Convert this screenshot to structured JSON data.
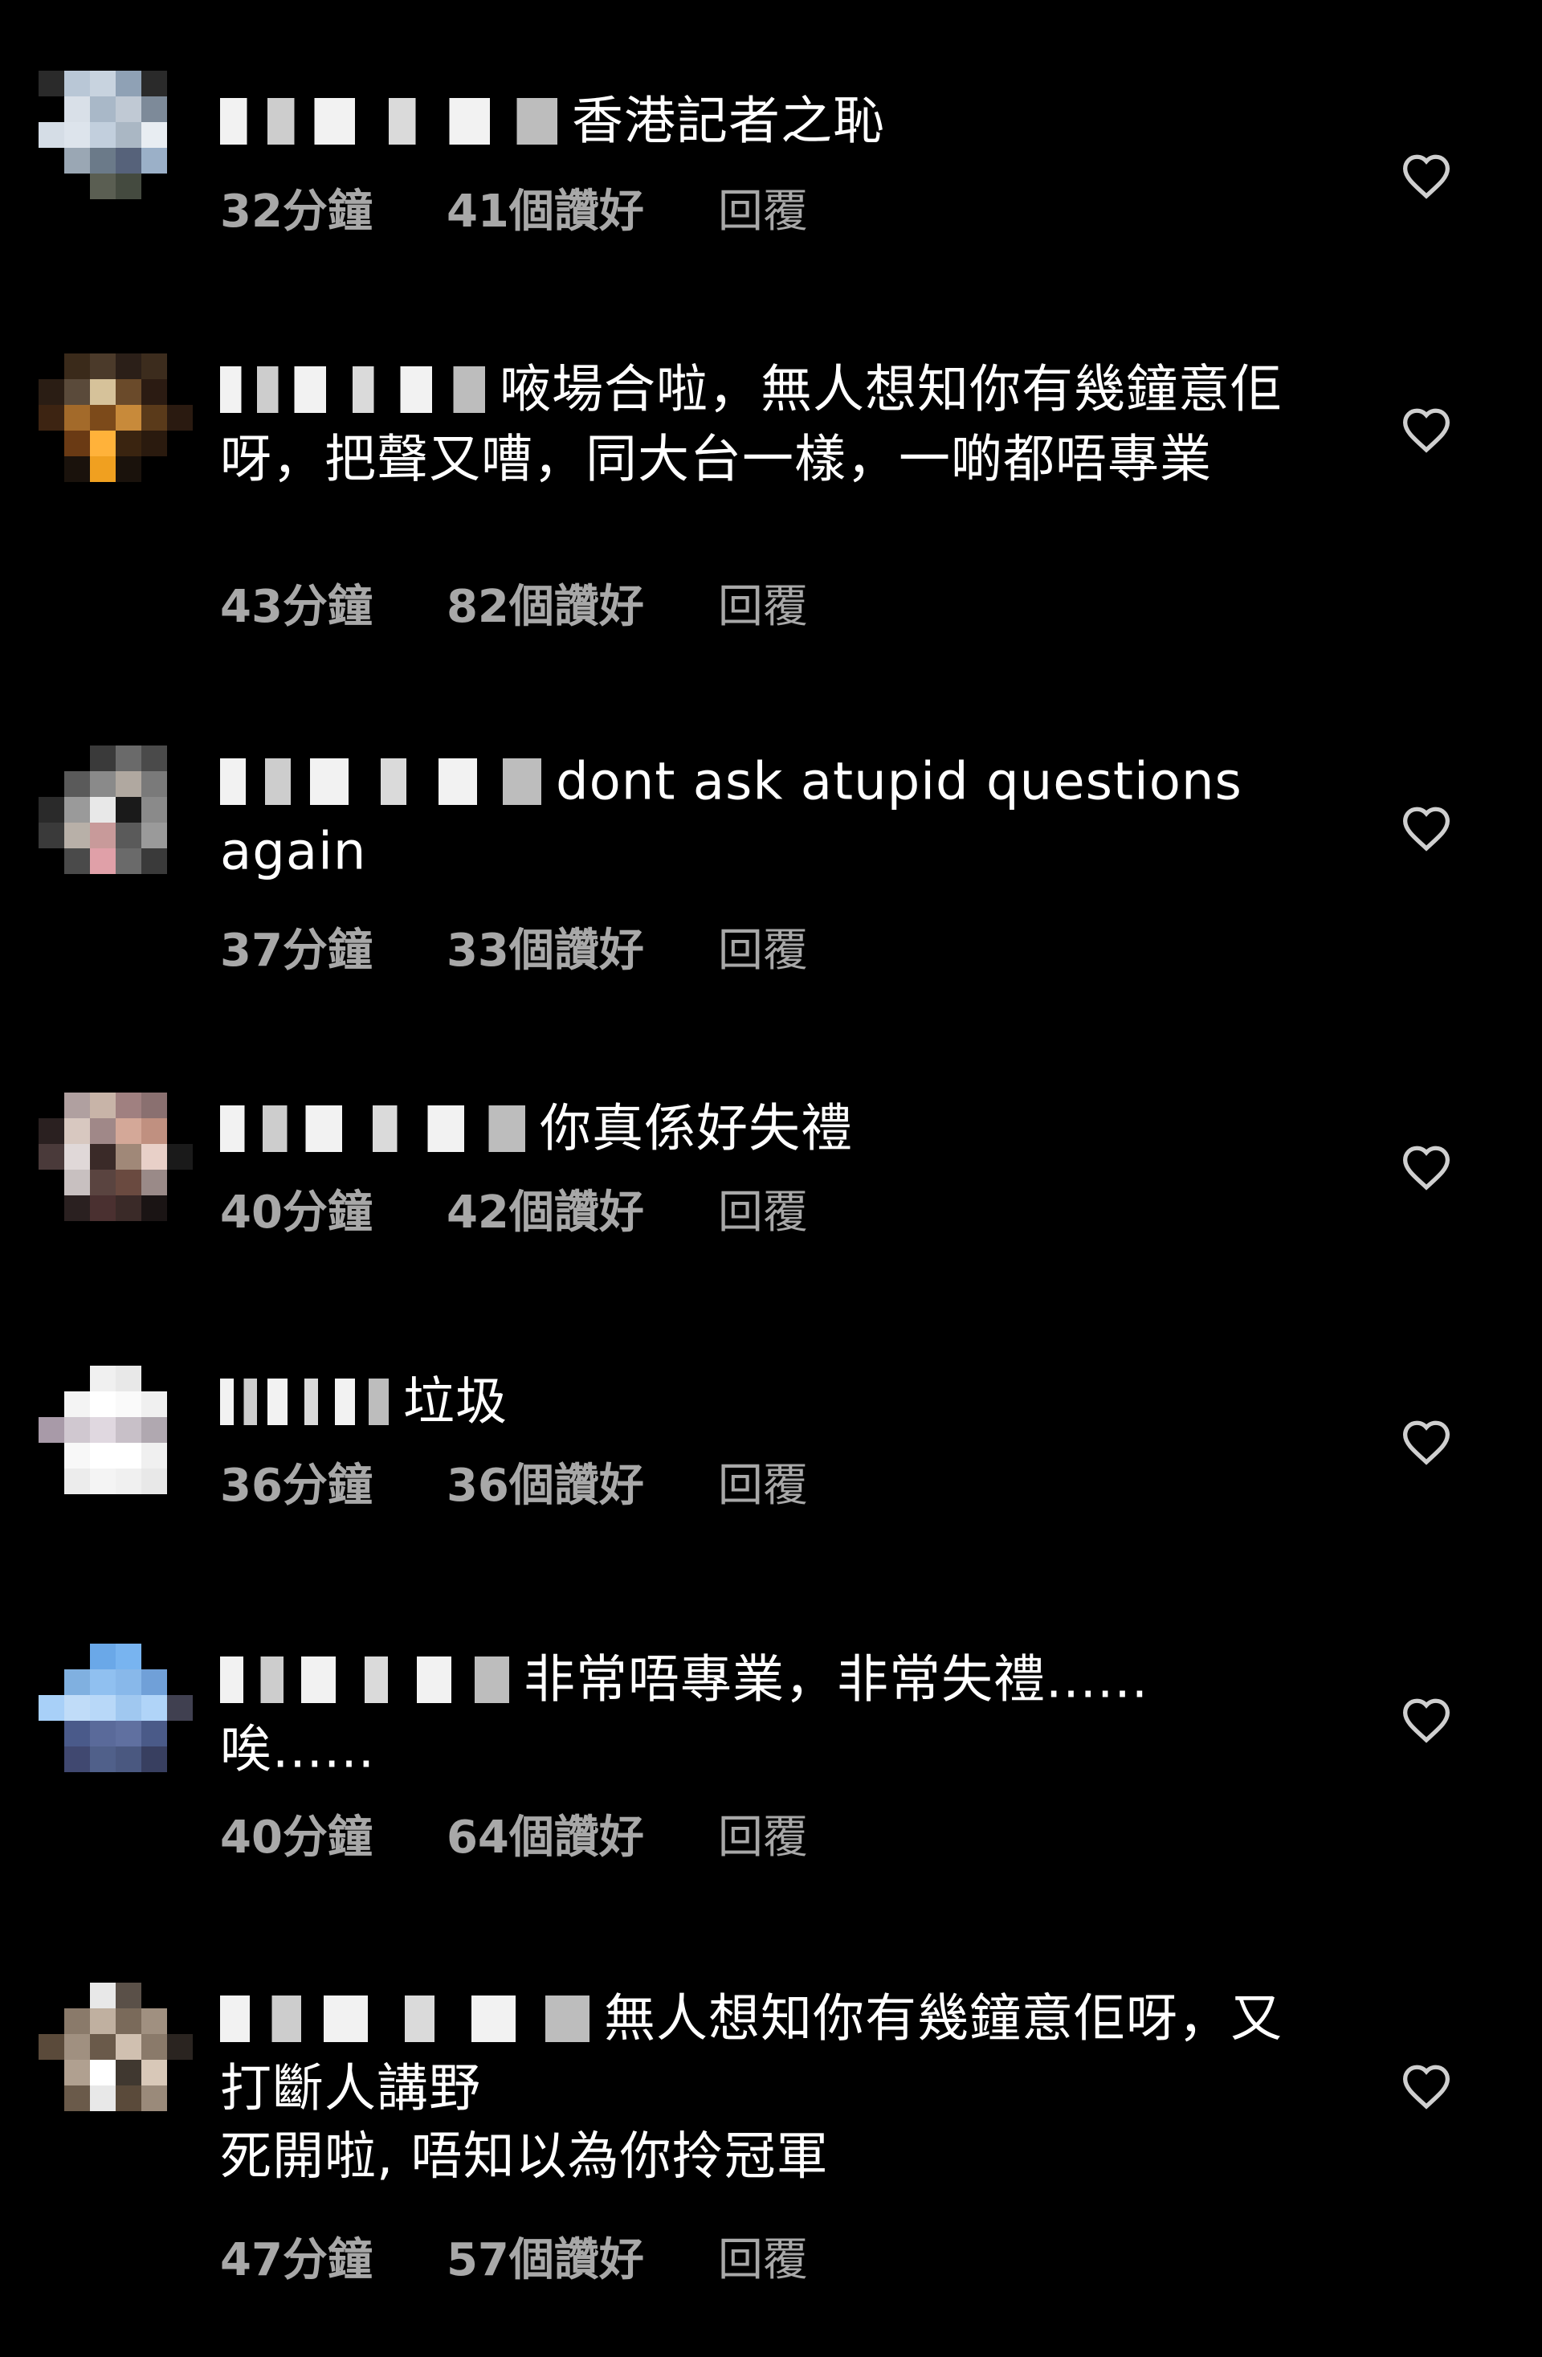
{
  "comments": [
    {
      "text": "香港記者之恥",
      "time": "32分鐘",
      "likes": "41個讚好",
      "reply": "回覆",
      "avatar": [
        "#2a2a2a",
        "#b9c7d6",
        "#c8d3df",
        "#8fa1b5",
        "#2a2a2a",
        "#000000",
        "#000000",
        "#d9e0e8",
        "#a9b8c8",
        "#c0c9d4",
        "#7d8a99",
        "#000000",
        "#d5dde6",
        "#dde4ec",
        "#c2cfdd",
        "#aab7c4",
        "#e8edf2",
        "#000000",
        "#000000",
        "#9aa7b4",
        "#6b7a89",
        "#56627a",
        "#9bb0c8",
        "#000000",
        "#000000",
        "#000000",
        "#5a5e52",
        "#444a3f",
        "#000000",
        "#000000",
        "#000000",
        "#000000",
        "#000000",
        "#000000",
        "#000000",
        "#000000"
      ]
    },
    {
      "text": "㖡場合啦，無人想知你有幾鐘意佢呀，把聲又嘈，同大台一樣，一啲都唔專業",
      "time": "43分鐘",
      "likes": "82個讚好",
      "reply": "回覆",
      "avatar": [
        "#000000",
        "#3a2a1a",
        "#4b3a2a",
        "#2b1f18",
        "#3c2c1d",
        "#000000",
        "#2a1d14",
        "#5a4a3a",
        "#d6c29a",
        "#6a4a2a",
        "#2b1b12",
        "#000000",
        "#3d2412",
        "#a36a2a",
        "#7c4a1a",
        "#c88a3a",
        "#5a3a1a",
        "#2a1a10",
        "#000000",
        "#6a3a14",
        "#ffb23a",
        "#3a2410",
        "#2a1a0e",
        "#000000",
        "#000000",
        "#1a120c",
        "#f0a020",
        "#1a120c",
        "#000000",
        "#000000",
        "#000000",
        "#000000",
        "#000000",
        "#000000",
        "#000000",
        "#000000"
      ]
    },
    {
      "text": "dont ask atupid questions again",
      "time": "37分鐘",
      "likes": "33個讚好",
      "reply": "回覆",
      "avatar": [
        "#000000",
        "#000000",
        "#3a3a3a",
        "#6a6a6a",
        "#4a4a4a",
        "#000000",
        "#000000",
        "#5a5a5a",
        "#8a8a8a",
        "#b0a8a0",
        "#7a7a7a",
        "#000000",
        "#2a2a2a",
        "#9a9a9a",
        "#e8e8e8",
        "#1a1a1a",
        "#8a8a8a",
        "#000000",
        "#3a3a3a",
        "#b8b0a8",
        "#c89a9a",
        "#5a5a5a",
        "#9a9a9a",
        "#000000",
        "#000000",
        "#4a4a4a",
        "#e0a0a8",
        "#6a6a6a",
        "#3a3a3a",
        "#000000",
        "#000000",
        "#000000",
        "#000000",
        "#000000",
        "#000000",
        "#000000"
      ]
    },
    {
      "text": "你真係好失禮",
      "time": "40分鐘",
      "likes": "42個讚好",
      "reply": "回覆",
      "avatar": [
        "#000000",
        "#b0a0a0",
        "#c8b4a8",
        "#a08080",
        "#8a7070",
        "#000000",
        "#2a2020",
        "#d8c8c0",
        "#a08888",
        "#d4a898",
        "#c09080",
        "#000000",
        "#4a3a3a",
        "#e0d8d8",
        "#3a2a28",
        "#a08878",
        "#e8d0c8",
        "#1a1a1a",
        "#000000",
        "#c8c0c0",
        "#5a4440",
        "#6a4a40",
        "#9a8a88",
        "#000000",
        "#000000",
        "#2a2020",
        "#4a3030",
        "#3a2a28",
        "#1a1414",
        "#000000",
        "#000000",
        "#000000",
        "#000000",
        "#000000",
        "#000000",
        "#000000"
      ]
    },
    {
      "text": "垃圾",
      "time": "36分鐘",
      "likes": "36個讚好",
      "reply": "回覆",
      "avatar": [
        "#000000",
        "#000000",
        "#f0f0f0",
        "#e8e8e8",
        "#000000",
        "#000000",
        "#000000",
        "#f4f4f4",
        "#ffffff",
        "#fafafa",
        "#f0f0f0",
        "#000000",
        "#a89aa8",
        "#d0c8d0",
        "#e0d8e0",
        "#c8c0c8",
        "#b0a8b0",
        "#000000",
        "#000000",
        "#f8f8f8",
        "#ffffff",
        "#ffffff",
        "#f0f0f0",
        "#000000",
        "#000000",
        "#ececec",
        "#f4f4f4",
        "#f0f0f0",
        "#e8e8e8",
        "#000000",
        "#000000",
        "#000000",
        "#000000",
        "#000000",
        "#000000",
        "#000000"
      ]
    },
    {
      "text": "非常唔專業，非常失禮......唉......",
      "time": "40分鐘",
      "likes": "64個讚好",
      "reply": "回覆",
      "avatar": [
        "#000000",
        "#000000",
        "#6aa8e8",
        "#78b4f0",
        "#000000",
        "#000000",
        "#000000",
        "#80b0e0",
        "#90c0f0",
        "#88b8ea",
        "#70a0d8",
        "#000000",
        "#a8d0f8",
        "#c0dcf8",
        "#b8d8f8",
        "#a0c8f0",
        "#b0d4f8",
        "#404050",
        "#000000",
        "#4a5a8a",
        "#5a6a9a",
        "#6070a0",
        "#4a5a88",
        "#000000",
        "#000000",
        "#404870",
        "#50608a",
        "#4a5880",
        "#383f60",
        "#000000",
        "#000000",
        "#000000",
        "#000000",
        "#000000",
        "#000000",
        "#000000"
      ]
    },
    {
      "text": "無人想知你有幾鐘意佢呀，又打斷人講野",
      "text2": "死開啦, 唔知以為你拎冠軍",
      "time": "47分鐘",
      "likes": "57個讚好",
      "reply": "回覆",
      "avatar": [
        "#000000",
        "#000000",
        "#e8e8e8",
        "#5a5048",
        "#000000",
        "#000000",
        "#000000",
        "#8a7a6a",
        "#c0b0a0",
        "#7a6a5a",
        "#a09080",
        "#000000",
        "#5a4a3a",
        "#a09080",
        "#6a5a4a",
        "#d0c0b0",
        "#8a7a6a",
        "#2a2420",
        "#000000",
        "#b0a090",
        "#ffffff",
        "#403830",
        "#d8c8b8",
        "#000000",
        "#000000",
        "#6a5a4a",
        "#e8e8e8",
        "#5a4a3a",
        "#9a8a7a",
        "#000000",
        "#000000",
        "#000000",
        "#000000",
        "#000000",
        "#000000",
        "#000000"
      ]
    }
  ],
  "colors": {
    "background": "#000000",
    "text": "#ffffff",
    "meta": "#a8a8a8"
  },
  "icons": {
    "like": "heart-icon"
  }
}
